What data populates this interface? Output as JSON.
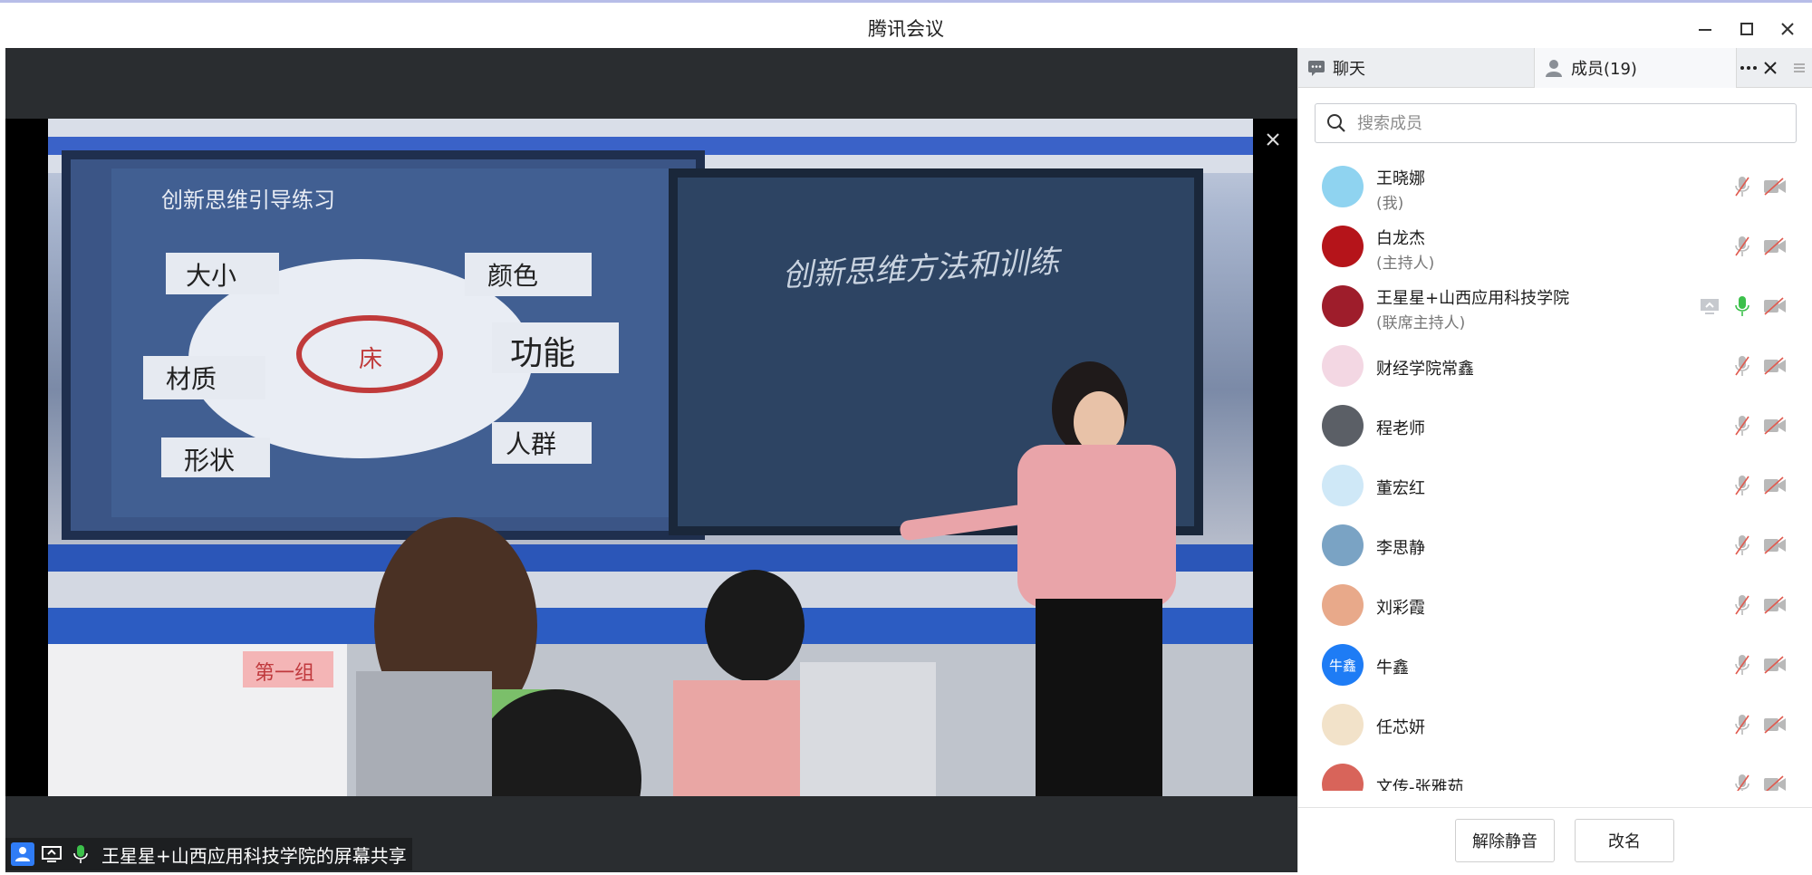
{
  "window": {
    "title": "腾讯会议"
  },
  "video": {
    "slide_title": "创新思维引导练习",
    "center_word": "床",
    "labels": [
      "大小",
      "颜色",
      "功能",
      "材质",
      "形状",
      "人群"
    ],
    "board_text": "创新思维方法和训练",
    "table_sign": "第一组"
  },
  "share_status": {
    "text": "王星星+山西应用科技学院的屏幕共享"
  },
  "panel": {
    "tab_chat": "聊天",
    "tab_members": "成员(19)",
    "search_placeholder": "搜索成员",
    "members": [
      {
        "name": "王晓娜",
        "role": "(我)",
        "avatar_text": "",
        "avatar_color": "#8fd3f0",
        "mic_on": false
      },
      {
        "name": "白龙杰",
        "role": "(主持人)",
        "avatar_text": "",
        "avatar_color": "#b5141a",
        "mic_on": false
      },
      {
        "name": "王星星+山西应用科技学院",
        "role": "(联席主持人)",
        "avatar_text": "",
        "avatar_color": "#9e1d2b",
        "mic_on": true,
        "sharing": true
      },
      {
        "name": "财经学院常鑫",
        "role": "",
        "avatar_text": "",
        "avatar_color": "#f3d7e3",
        "mic_on": false
      },
      {
        "name": "程老师",
        "role": "",
        "avatar_text": "",
        "avatar_color": "#5b5f66",
        "mic_on": false
      },
      {
        "name": "董宏红",
        "role": "",
        "avatar_text": "",
        "avatar_color": "#cfe8f7",
        "mic_on": false
      },
      {
        "name": "李思静",
        "role": "",
        "avatar_text": "",
        "avatar_color": "#7aa3c4",
        "mic_on": false
      },
      {
        "name": "刘彩霞",
        "role": "",
        "avatar_text": "",
        "avatar_color": "#e8a98a",
        "mic_on": false
      },
      {
        "name": "牛鑫",
        "role": "",
        "avatar_text": "牛鑫",
        "avatar_color": "#1e7cf5",
        "mic_on": false
      },
      {
        "name": "任芯妍",
        "role": "",
        "avatar_text": "",
        "avatar_color": "#f2e2c9",
        "mic_on": false
      },
      {
        "name": "文传-张雅茹",
        "role": "",
        "avatar_text": "",
        "avatar_color": "#d8645a",
        "mic_on": false
      }
    ],
    "unmute_button": "解除静音",
    "rename_button": "改名"
  },
  "colors": {
    "accent": "#1e7cf5",
    "mic_on": "#3cc04b",
    "muted_icon": "#b9b9b9",
    "muted_slash": "#e05a4f"
  }
}
